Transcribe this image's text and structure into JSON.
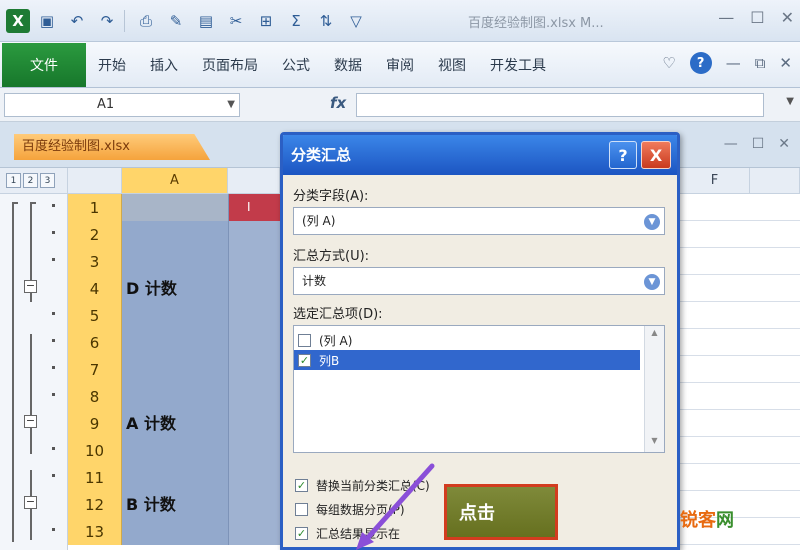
{
  "titlebar": {
    "doc_title": "百度经验制图.xlsx M...",
    "qa_icons": [
      "excel-app-icon",
      "save-icon",
      "undo-icon",
      "redo-icon",
      "print-icon",
      "format-painter-icon",
      "paste-icon",
      "cut-icon",
      "table-icon",
      "sum-icon",
      "sort-icon",
      "filter-icon"
    ]
  },
  "ribbon": {
    "file_tab": "文件",
    "tabs": [
      "开始",
      "插入",
      "页面布局",
      "公式",
      "数据",
      "审阅",
      "视图",
      "开发工具"
    ]
  },
  "formula_bar": {
    "name_box": "A1",
    "fx": "fx"
  },
  "workbook": {
    "tab_label": "百度经验制图.xlsx"
  },
  "grid": {
    "outline_levels": [
      "1",
      "2",
      "3"
    ],
    "columns": [
      "A",
      "F"
    ],
    "b1_partial": "I",
    "rows": [
      {
        "num": "1",
        "a": ""
      },
      {
        "num": "2",
        "a": ""
      },
      {
        "num": "3",
        "a": ""
      },
      {
        "num": "4",
        "a": "D 计数"
      },
      {
        "num": "5",
        "a": ""
      },
      {
        "num": "6",
        "a": ""
      },
      {
        "num": "7",
        "a": ""
      },
      {
        "num": "8",
        "a": ""
      },
      {
        "num": "9",
        "a": "A 计数"
      },
      {
        "num": "10",
        "a": ""
      },
      {
        "num": "11",
        "a": ""
      },
      {
        "num": "12",
        "a": "B 计数"
      },
      {
        "num": "13",
        "a": ""
      }
    ]
  },
  "dialog": {
    "title": "分类汇总",
    "help": "?",
    "close": "X",
    "group_field_label": "分类字段(A):",
    "group_field_value": "(列 A)",
    "function_label": "汇总方式(U):",
    "function_value": "计数",
    "subtotal_label": "选定汇总项(D):",
    "subtotal_items": [
      {
        "label": "(列 A)",
        "checked": false
      },
      {
        "label": "列B",
        "checked": true
      }
    ],
    "options": [
      {
        "label": "替换当前分类汇总(C)",
        "checked": true
      },
      {
        "label": "每组数据分页(P)",
        "checked": false
      },
      {
        "label": "汇总结果显示在",
        "checked": true
      }
    ]
  },
  "overlay": {
    "click_label": "点击"
  },
  "watermark": {
    "part1": "锐客",
    "part2": "网"
  }
}
